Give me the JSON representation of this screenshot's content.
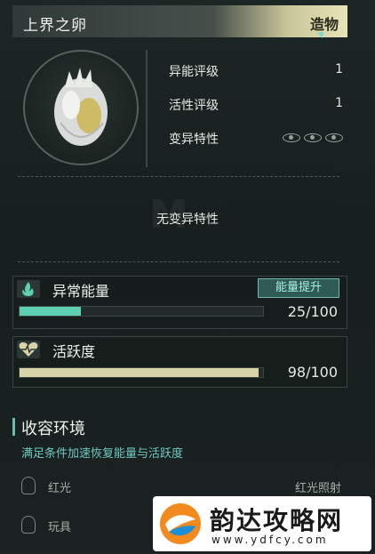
{
  "header": {
    "title": "上界之卵",
    "tag": "造物"
  },
  "stats": [
    {
      "label": "异能评级",
      "value": "1"
    },
    {
      "label": "活性评级",
      "value": "1"
    },
    {
      "label": "变异特性",
      "value": ""
    }
  ],
  "mutation_text": "无变异特性",
  "energy": {
    "title": "异常能量",
    "boost_label": "能量提升",
    "current": 25,
    "max": 100,
    "display": "25/100",
    "fraction": 0.25,
    "color": "#5ecfb3",
    "icon": "flame-icon"
  },
  "vitality": {
    "title": "活跃度",
    "current": 98,
    "max": 100,
    "display": "98/100",
    "fraction": 0.98,
    "color": "#d8d3a8",
    "icon": "heart-pulse-icon"
  },
  "environment": {
    "title": "收容环境",
    "subtitle": "满足条件加速恢复能量与活跃度",
    "rows": [
      {
        "label": "红光",
        "requirement": "红光照射",
        "icon": "lightbulb-icon"
      },
      {
        "label": "玩具",
        "requirement": "",
        "icon": "toy-icon"
      }
    ]
  },
  "watermark": {
    "name": "韵达攻略网",
    "url": "www.ydfcy.com"
  }
}
